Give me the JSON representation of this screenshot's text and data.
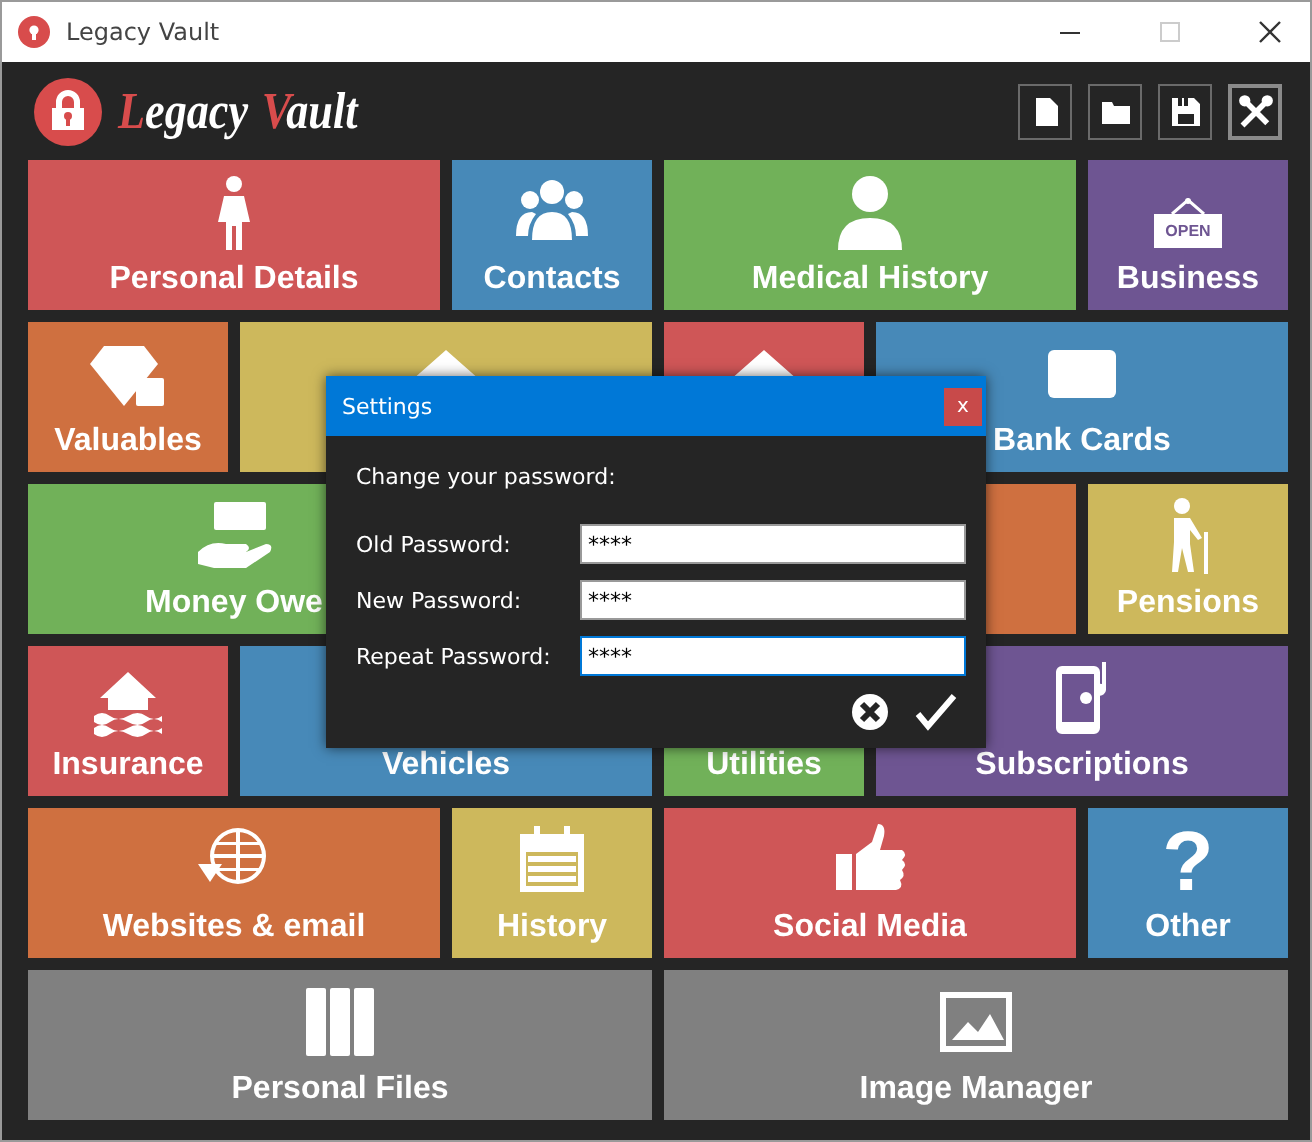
{
  "window": {
    "title": "Legacy Vault"
  },
  "header": {
    "logo_words": [
      "Legacy",
      "Vault"
    ],
    "toolbar": [
      {
        "selected": false
      },
      {
        "selected": false
      },
      {
        "selected": false
      },
      {
        "selected": true
      }
    ]
  },
  "tiles": [
    {
      "label": "Personal Details",
      "color": "#cf5657"
    },
    {
      "label": "Contacts",
      "color": "#4789b8"
    },
    {
      "label": "Medical History",
      "color": "#71b159"
    },
    {
      "label": "Business",
      "color": "#6e5592",
      "sign_text": "OPEN"
    },
    {
      "label": "Valuables",
      "color": "#cf7040"
    },
    {
      "color": "#cdb85c"
    },
    {
      "color": "#cf5657"
    },
    {
      "label": "Bank Cards",
      "color": "#4789b8"
    },
    {
      "label": "Money Owe",
      "color": "#71b159"
    },
    {
      "color": "#cf7040"
    },
    {
      "label": "Pensions",
      "color": "#cdb85c"
    },
    {
      "label": "Insurance",
      "color": "#cf5657"
    },
    {
      "label": "Vehicles",
      "color": "#4789b8"
    },
    {
      "label": "Utilities",
      "color": "#71b159"
    },
    {
      "label": "Subscriptions",
      "color": "#6e5592"
    },
    {
      "label": "Websites & email",
      "color": "#cf7040"
    },
    {
      "label": "History",
      "color": "#cdb85c"
    },
    {
      "label": "Social Media",
      "color": "#cf5657"
    },
    {
      "label": "Other",
      "color": "#4789b8",
      "glyph": "?"
    },
    {
      "label": "Personal Files",
      "color": "#808080"
    },
    {
      "label": "Image Manager",
      "color": "#808080"
    }
  ],
  "dialog": {
    "title": "Settings",
    "close": "x",
    "heading": "Change your password:",
    "fields": [
      {
        "label": "Old Password:",
        "value": "****",
        "focused": false
      },
      {
        "label": "New Password:",
        "value": "****",
        "focused": false
      },
      {
        "label": "Repeat Password:",
        "value": "****",
        "focused": true
      }
    ]
  }
}
